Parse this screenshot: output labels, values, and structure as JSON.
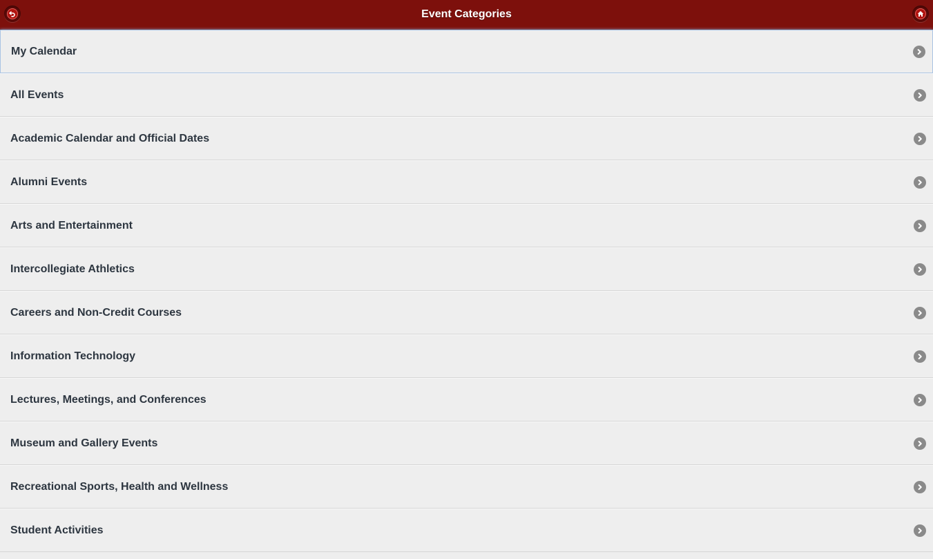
{
  "header": {
    "title": "Event Categories",
    "back_icon": "back-icon",
    "home_icon": "home-icon",
    "color": "#7d100c"
  },
  "categories": [
    {
      "label": "My Calendar",
      "focused": true
    },
    {
      "label": "All Events"
    },
    {
      "label": "Academic Calendar and Official Dates"
    },
    {
      "label": "Alumni Events"
    },
    {
      "label": "Arts and Entertainment"
    },
    {
      "label": "Intercollegiate Athletics"
    },
    {
      "label": "Careers and Non-Credit Courses"
    },
    {
      "label": "Information Technology"
    },
    {
      "label": "Lectures, Meetings, and Conferences"
    },
    {
      "label": "Museum and Gallery Events"
    },
    {
      "label": "Recreational Sports, Health and Wellness"
    },
    {
      "label": "Student Activities"
    }
  ],
  "item_icon": "chevron-right-icon"
}
